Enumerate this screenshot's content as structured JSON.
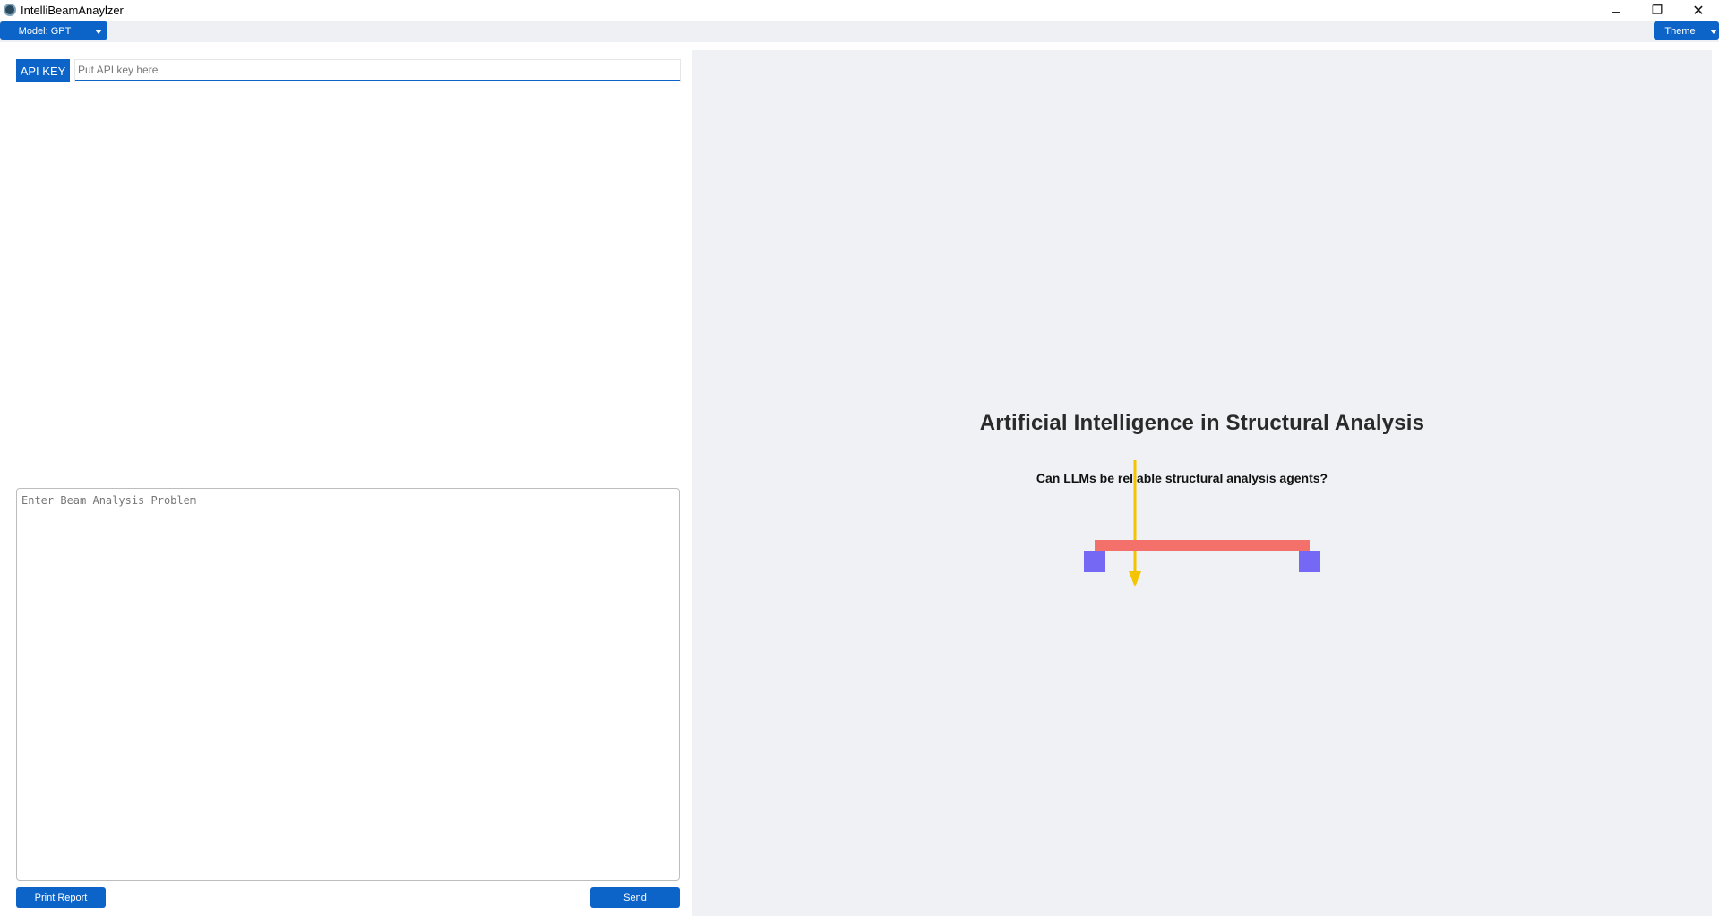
{
  "window": {
    "title": "IntelliBeamAnaylzer",
    "controls": {
      "minimize": "–",
      "maximize": "❐",
      "close": "✕"
    }
  },
  "menu": {
    "model_label": "Model: GPT",
    "theme_label": "Theme"
  },
  "api": {
    "label": "API KEY",
    "placeholder": "Put API key here",
    "value": ""
  },
  "problem": {
    "placeholder": "Enter Beam Analysis Problem",
    "value": ""
  },
  "actions": {
    "print_label": "Print Report",
    "send_label": "Send"
  },
  "splash": {
    "title": "Artificial Intelligence in Structural Analysis",
    "subtitle": "Can LLMs be reliable structural analysis agents?"
  },
  "diagram": {
    "beam_color": "#f4716b",
    "support_color": "#7468f4",
    "load_color": "#f5c400"
  },
  "colors": {
    "accent": "#0d64c8",
    "pane_background": "#f0f1f5"
  },
  "icons": {
    "app": "app-logo-icon",
    "model_caret": "chevron-down-icon",
    "theme_caret": "chevron-down-icon"
  }
}
